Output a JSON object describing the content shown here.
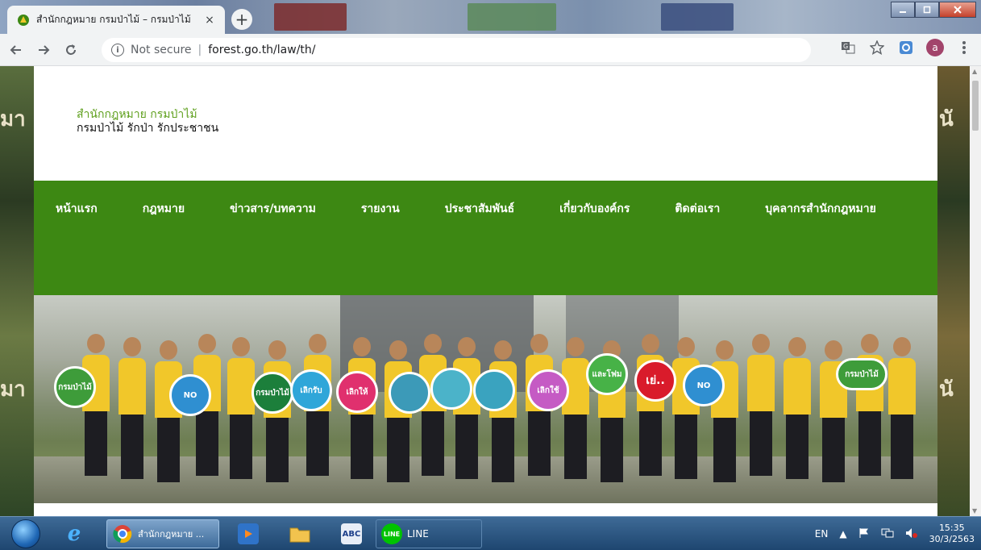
{
  "browser": {
    "tab_title": "สำนักกฎหมาย กรมป่าไม้ – กรมป่าไม้",
    "tab_close": "×",
    "new_tab": "+",
    "url_secure": "Not secure",
    "url": "forest.go.th/law/th/",
    "profile_initial": "a"
  },
  "site": {
    "title": "สำนักกฎหมาย กรมป่าไม้",
    "tagline": "กรมป่าไม้ รักป่า รักประชาชน",
    "nav": [
      "หน้าแรก",
      "กฎหมาย",
      "ข่าวสาร/บทความ",
      "รายงาน",
      "ประชาสัมพันธ์",
      "เกี่ยวกับองค์กร",
      "ติดต่อเรา",
      "บุคลากรสำนักกฎหมาย"
    ],
    "hero_signs": [
      "กรมป่าไม้",
      "เลิกรับ",
      "เลิกให้",
      "NO",
      "เลิกใช้",
      "และโฟม",
      "เย่..",
      "NO"
    ],
    "background_text": [
      "มา",
      "นั"
    ]
  },
  "taskbar": {
    "chrome_label": "สำนักกฎหมาย ...",
    "line_label": "LINE",
    "abc_label": "ABC",
    "lang": "EN",
    "time": "15:35",
    "date": "30/3/2563"
  },
  "colors": {
    "nav_green": "#3d8813",
    "title_green": "#5fa01e",
    "shirt_yellow": "#f1c72a"
  }
}
